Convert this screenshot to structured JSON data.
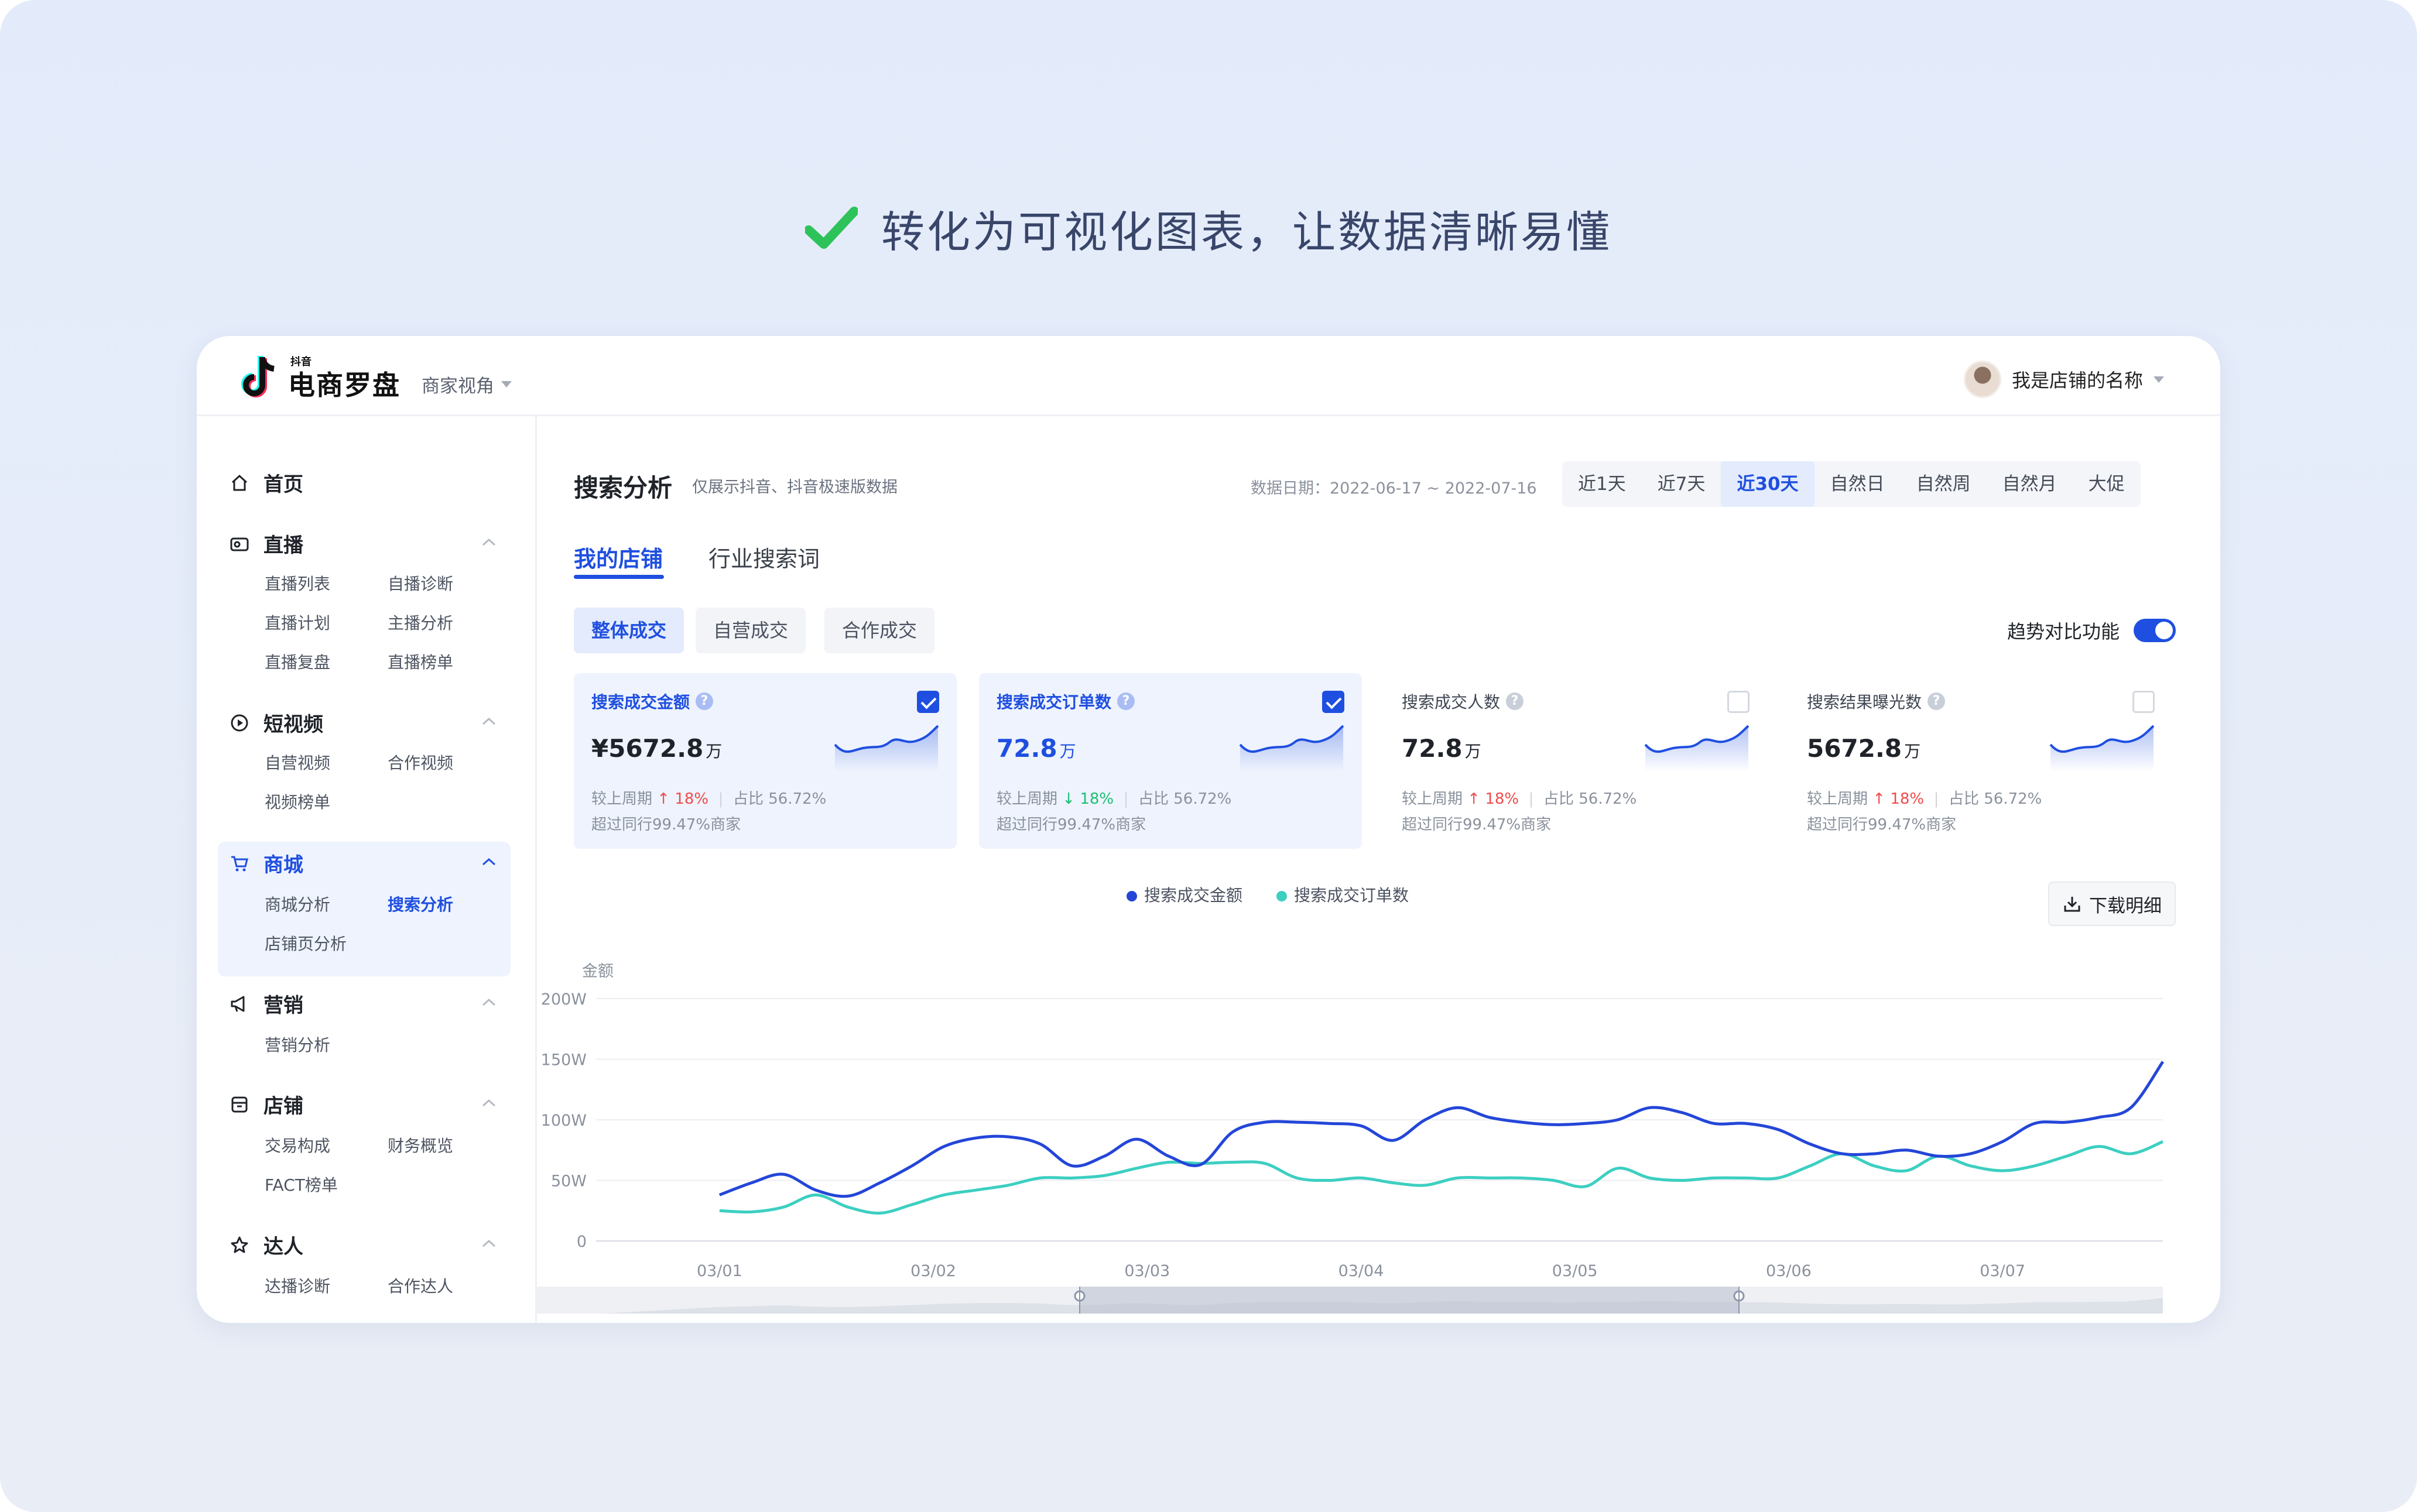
{
  "headline": {
    "text": "转化为可视化图表，让数据清晰易懂"
  },
  "topbar": {
    "brand_small": "抖音",
    "brand": "电商罗盘",
    "view_selector": "商家视角",
    "store_name": "我是店铺的名称"
  },
  "sidebar": {
    "home": "首页",
    "groups": [
      {
        "label": "直播",
        "items": [
          "直播列表",
          "自播诊断",
          "直播计划",
          "主播分析",
          "直播复盘",
          "直播榜单"
        ]
      },
      {
        "label": "短视频",
        "items": [
          "自营视频",
          "合作视频",
          "视频榜单"
        ]
      },
      {
        "label": "商城",
        "items": [
          "商城分析",
          "搜索分析",
          "店铺页分析"
        ]
      },
      {
        "label": "营销",
        "items": [
          "营销分析"
        ]
      },
      {
        "label": "店铺",
        "items": [
          "交易构成",
          "财务概览",
          "FACT榜单"
        ]
      },
      {
        "label": "达人",
        "items": [
          "达播诊断",
          "合作达人"
        ]
      }
    ]
  },
  "main": {
    "title": "搜索分析",
    "subtitle": "仅展示抖音、抖音极速版数据",
    "date_range": "数据日期：2022-06-17 ~ 2022-07-16",
    "ranges": [
      "近1天",
      "近7天",
      "近30天",
      "自然日",
      "自然周",
      "自然月",
      "大促"
    ],
    "active_range": "近30天",
    "tabs": [
      "我的店铺",
      "行业搜索词"
    ],
    "chips": [
      "整体成交",
      "自营成交",
      "合作成交"
    ],
    "trend_label": "趋势对比功能",
    "trend_on": true,
    "metrics": [
      {
        "label": "搜索成交金额",
        "value": "¥5672.8",
        "unit": "万",
        "cmp_label": "较上周期",
        "cmp_dir": "↑",
        "cmp_value": "18%",
        "share": "占比 56.72%",
        "rank": "超过同行99.47%商家",
        "checked": true
      },
      {
        "label": "搜索成交订单数",
        "value": "72.8",
        "unit": "万",
        "cmp_label": "较上周期",
        "cmp_dir": "↓",
        "cmp_value": "18%",
        "share": "占比 56.72%",
        "rank": "超过同行99.47%商家",
        "checked": true
      },
      {
        "label": "搜索成交人数",
        "value": "72.8",
        "unit": "万",
        "cmp_label": "较上周期",
        "cmp_dir": "↑",
        "cmp_value": "18%",
        "share": "占比 56.72%",
        "rank": "超过同行99.47%商家",
        "checked": false
      },
      {
        "label": "搜索结果曝光数",
        "value": "5672.8",
        "unit": "万",
        "cmp_label": "较上周期",
        "cmp_dir": "↑",
        "cmp_value": "18%",
        "share": "占比 56.72%",
        "rank": "超过同行99.47%商家",
        "checked": false
      }
    ],
    "download_label": "下载明细"
  },
  "colors": {
    "accent": "#1f4fe0",
    "series1": "#2446d8",
    "series2": "#3ccfc1",
    "up": "#f04b4b",
    "down": "#1dbf73"
  },
  "chart_data": {
    "type": "line",
    "ylabel": "金额",
    "y_ticks": [
      "200W",
      "150W",
      "100W",
      "50W",
      "0"
    ],
    "ylim": [
      0,
      200
    ],
    "x_ticks": [
      "03/01",
      "03/02",
      "03/03",
      "03/04",
      "03/05",
      "03/06",
      "03/07"
    ],
    "x": [
      0.0,
      0.15,
      0.3,
      0.45,
      0.6,
      0.75,
      0.9,
      1.05,
      1.2,
      1.35,
      1.5,
      1.65,
      1.8,
      1.95,
      2.1,
      2.25,
      2.4,
      2.55,
      2.7,
      2.85,
      3.0,
      3.15,
      3.3,
      3.45,
      3.6,
      3.75,
      3.9,
      4.05,
      4.2,
      4.35,
      4.5,
      4.65,
      4.8,
      4.95,
      5.1,
      5.25,
      5.4,
      5.55,
      5.7,
      5.85,
      6.0,
      6.15,
      6.3,
      6.45,
      6.6,
      6.75
    ],
    "legend_position": "top",
    "series": [
      {
        "name": "搜索成交金额",
        "values": [
          38,
          48,
          55,
          42,
          37,
          48,
          62,
          78,
          85,
          86,
          80,
          62,
          70,
          84,
          70,
          63,
          90,
          98,
          98,
          97,
          95,
          83,
          100,
          110,
          102,
          98,
          96,
          97,
          100,
          110,
          106,
          97,
          97,
          92,
          80,
          72,
          72,
          75,
          70,
          72,
          82,
          97,
          98,
          102,
          110,
          148
        ]
      },
      {
        "name": "搜索成交订单数",
        "values": [
          25,
          24,
          28,
          38,
          28,
          23,
          30,
          38,
          42,
          46,
          52,
          52,
          54,
          60,
          65,
          64,
          65,
          64,
          52,
          50,
          52,
          48,
          46,
          52,
          52,
          52,
          50,
          45,
          60,
          52,
          50,
          52,
          52,
          52,
          62,
          72,
          62,
          58,
          70,
          62,
          58,
          62,
          70,
          78,
          72,
          82
        ]
      }
    ]
  }
}
